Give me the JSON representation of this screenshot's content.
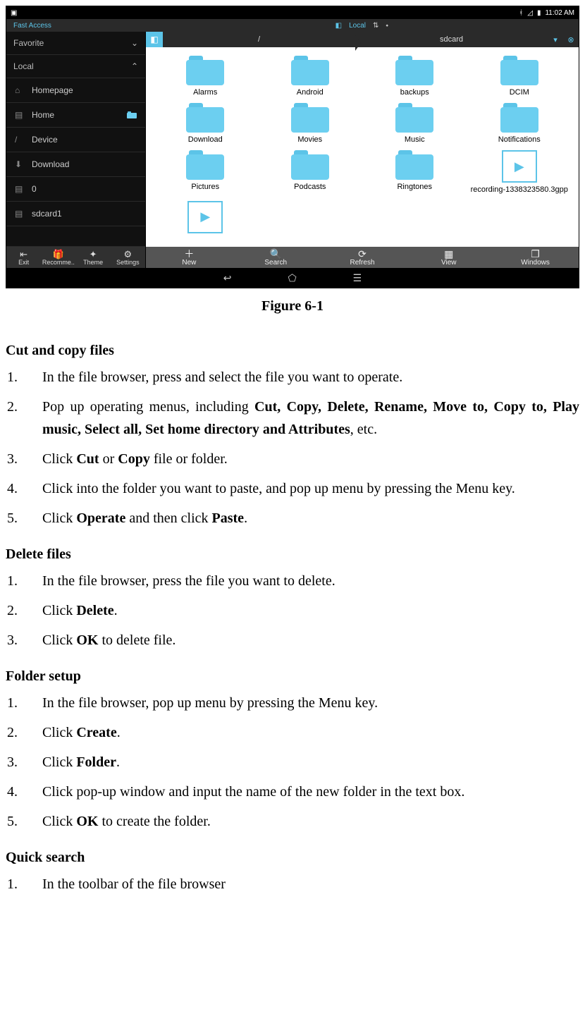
{
  "status": {
    "time": "11:02 AM"
  },
  "tabstrip": {
    "active": "Fast Access",
    "local": "Local"
  },
  "sidebar": {
    "sections": [
      "Favorite",
      "Local"
    ],
    "items": [
      "Homepage",
      "Home",
      "Device",
      "Download",
      "0",
      "sdcard1"
    ],
    "bottom": [
      "Exit",
      "Recomme..",
      "Theme",
      "Settings"
    ]
  },
  "path": {
    "seg1": "/",
    "seg2": "sdcard"
  },
  "grid": {
    "folders": [
      "Alarms",
      "Android",
      "backups",
      "DCIM",
      "Download",
      "Movies",
      "Music",
      "Notifications",
      "Pictures",
      "Podcasts",
      "Ringtones"
    ],
    "file": "recording-1338323580.3gpp"
  },
  "toolbar": [
    "New",
    "Search",
    "Refresh",
    "View",
    "Windows"
  ],
  "caption": "Figure 6-1",
  "sec1": {
    "title": "Cut and copy files",
    "steps": [
      "In the file browser, press and select the file you want to operate.",
      "Pop up operating menus, including <b>Cut, Copy, Delete, Rename, Move to, Copy to, Play music, Select all, Set home directory and Attributes</b>, etc.",
      "Click <b>Cut</b> or <b>Copy</b> file or folder.",
      "Click into the folder you want to paste, and pop up menu by pressing the Menu key.",
      "Click <b>Operate</b> and then click <b>Paste</b>."
    ]
  },
  "sec2": {
    "title": "Delete files",
    "steps": [
      "In the file browser, press the file you want to delete.",
      "Click <b>Delete</b>.",
      "Click <b>OK</b> to delete file."
    ]
  },
  "sec3": {
    "title": "Folder setup",
    "steps": [
      "In the file browser, pop up menu by pressing the Menu key.",
      "Click <b>Create</b>.",
      "Click <b>Folder</b>.",
      "Click pop-up window and input the name of the new folder in the text box.",
      "Click <b>OK</b> to create the folder."
    ]
  },
  "sec4": {
    "title": "Quick search",
    "steps": [
      "In the toolbar of the file browser"
    ]
  }
}
